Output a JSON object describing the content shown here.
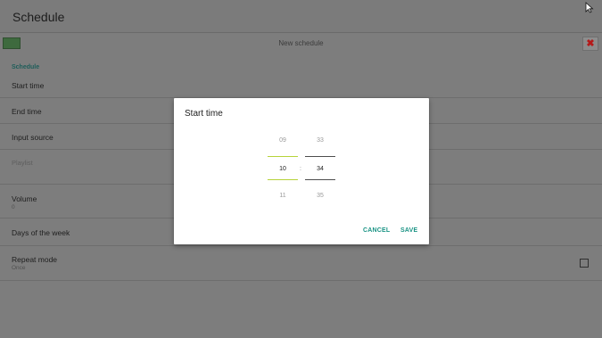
{
  "app": {
    "title": "Schedule"
  },
  "toolbar": {
    "title": "New schedule",
    "close_glyph": "✖"
  },
  "section": {
    "label": "Schedule"
  },
  "rows": {
    "start_time": {
      "label": "Start time"
    },
    "end_time": {
      "label": "End time"
    },
    "input_source": {
      "label": "Input source"
    },
    "playlist": {
      "label": "Playlist"
    },
    "volume": {
      "label": "Volume",
      "value": "0"
    },
    "days_of_week": {
      "label": "Days of the week"
    },
    "repeat_mode": {
      "label": "Repeat mode",
      "value": "Once"
    }
  },
  "dialog": {
    "title": "Start time",
    "hours": {
      "prev": "09",
      "selected": "10",
      "next": "11"
    },
    "minutes": {
      "prev": "33",
      "selected": "34",
      "next": "35"
    },
    "separator": ":",
    "cancel_label": "CANCEL",
    "save_label": "SAVE"
  },
  "colors": {
    "accent": "#1a9384",
    "picker_highlight": "#b6d33a",
    "close": "#b41a1a",
    "background": "#7d7d7d"
  },
  "icons": {
    "back": "back-icon",
    "close": "close-icon",
    "cursor": "mouse-cursor-icon",
    "checkbox": "checkbox-icon"
  }
}
